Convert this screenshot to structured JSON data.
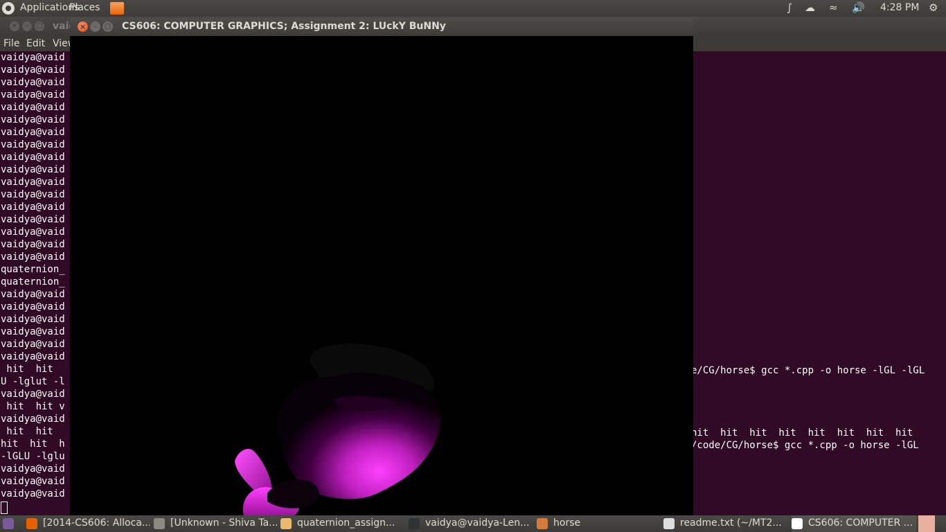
{
  "top_panel": {
    "applications": "Applications",
    "places": "Places",
    "clock": "4:28 PM"
  },
  "terminal": {
    "title": "vaid",
    "menu": [
      "File",
      "Edit",
      "View"
    ],
    "lines_left": [
      "vaidya@vaid",
      "vaidya@vaid",
      "vaidya@vaid",
      "vaidya@vaid",
      "vaidya@vaid",
      "vaidya@vaid",
      "vaidya@vaid",
      "vaidya@vaid",
      "vaidya@vaid",
      "vaidya@vaid",
      "vaidya@vaid",
      "vaidya@vaid",
      "vaidya@vaid",
      "vaidya@vaid",
      "vaidya@vaid",
      "vaidya@vaid",
      "vaidya@vaid",
      "quaternion_",
      "quaternion_",
      "vaidya@vaid",
      "vaidya@vaid",
      "vaidya@vaid",
      "vaidya@vaid",
      "vaidya@vaid",
      "vaidya@vaid",
      " hit  hit",
      "U -lglut -l",
      "vaidya@vaid",
      " hit  hit v",
      "vaidya@vaid",
      " hit  hit",
      "hit  hit  h",
      "-lGLU -lglu",
      "vaidya@vaid",
      "vaidya@vaid",
      "vaidya@vaid"
    ],
    "right_fragments": [
      "e/CG/horse$ gcc *.cpp -o horse -lGL -lGL",
      "hit  hit  hit  hit  hit  hit  hit  hit",
      "/code/CG/horse$ gcc *.cpp -o horse -lGL"
    ]
  },
  "gl_window": {
    "title": "CS606: COMPUTER GRAPHICS; Assignment 2: LUckY BuNNy"
  },
  "taskbar": {
    "items": [
      {
        "label": "[2014-CS606: Alloca...",
        "color": "#e66000"
      },
      {
        "label": "[Unknown - Shiva Ta...",
        "color": "#8a8a80"
      },
      {
        "label": "quaternion_assign...",
        "color": "#e9b96e"
      },
      {
        "label": "vaidya@vaidya-Len...",
        "color": "#2e3436"
      },
      {
        "label": "horse",
        "color": "#d47a3a"
      },
      {
        "label": "readme.txt (~/MT2...",
        "color": "#dddddd"
      },
      {
        "label": "CS606: COMPUTER ...",
        "color": "#ffffff"
      }
    ]
  }
}
